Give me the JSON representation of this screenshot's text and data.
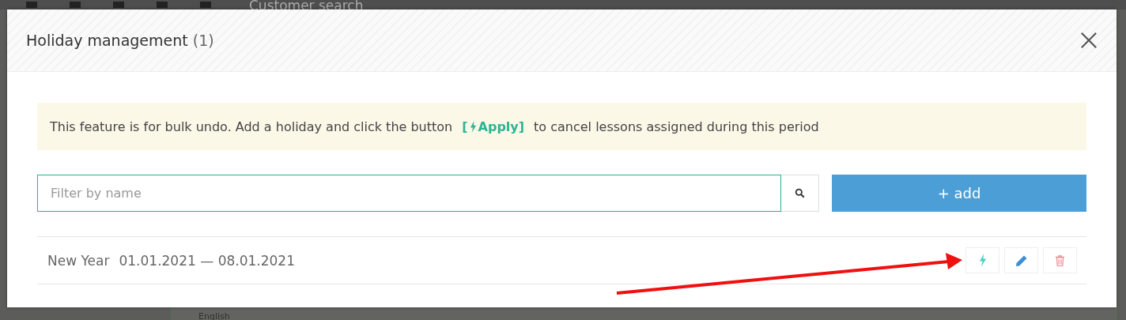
{
  "backdrop": {
    "search_placeholder": "Customer search",
    "language": "English"
  },
  "modal": {
    "title": "Holiday management",
    "count": "(1)"
  },
  "notice": {
    "text_before": "This feature is for bulk undo. Add a holiday and click the button",
    "link_open": "[",
    "link_label": "Apply]",
    "text_after": "to cancel lessons assigned during this period"
  },
  "filter": {
    "placeholder": "Filter by name"
  },
  "add_button": {
    "label": "+ add"
  },
  "holidays": [
    {
      "name": "New Year",
      "period": "01.01.2021 — 08.01.2021"
    }
  ]
}
